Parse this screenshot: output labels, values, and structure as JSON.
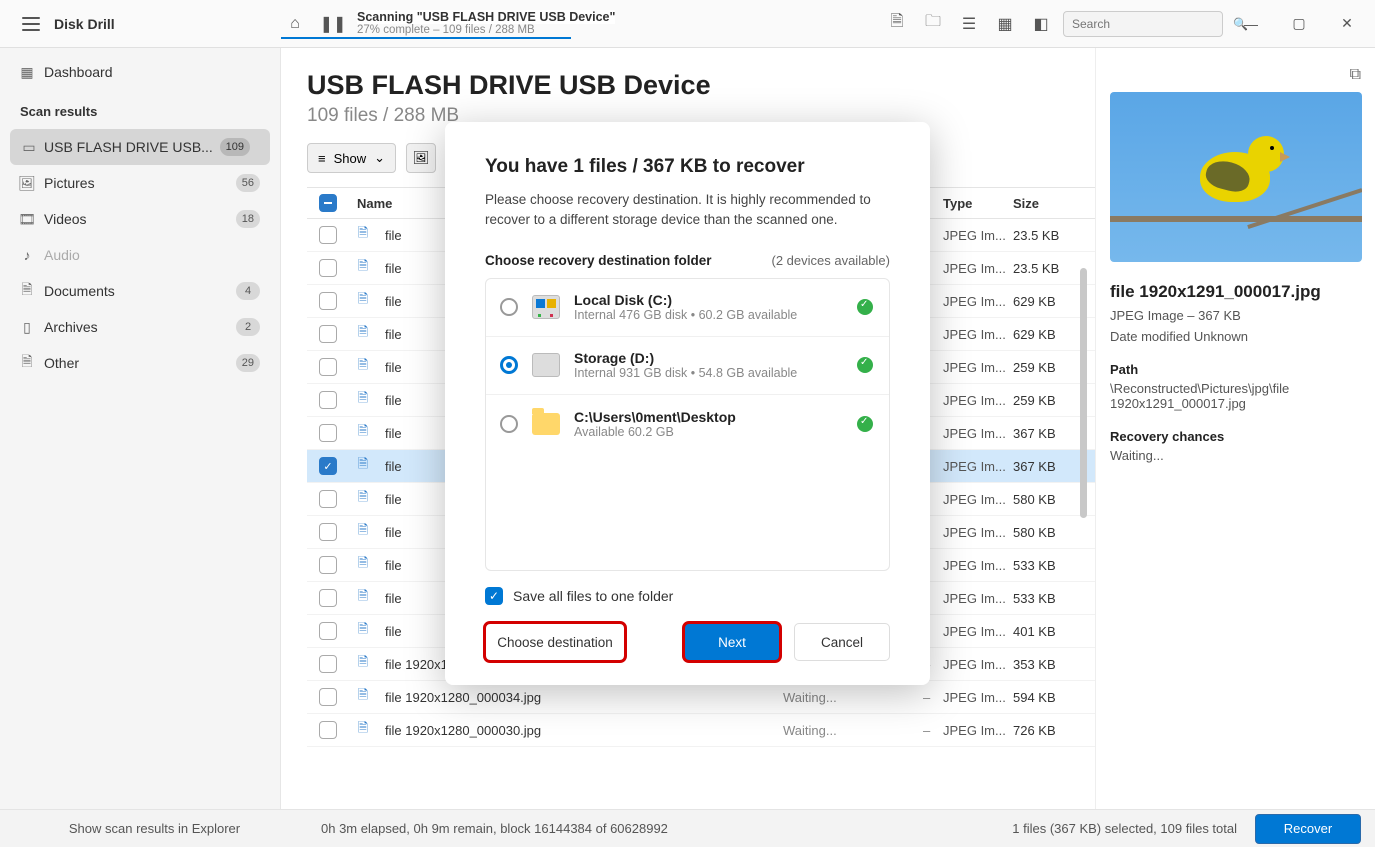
{
  "app": {
    "title": "Disk Drill"
  },
  "scan": {
    "title": "Scanning \"USB FLASH DRIVE USB Device\"",
    "subtitle": "27% complete – 109 files / 288 MB",
    "progress_pct": "27"
  },
  "search": {
    "placeholder": "Search"
  },
  "sidebar": {
    "dashboard": "Dashboard",
    "heading": "Scan results",
    "items": [
      {
        "label": "USB FLASH DRIVE USB...",
        "badge": "109"
      },
      {
        "label": "Pictures",
        "badge": "56"
      },
      {
        "label": "Videos",
        "badge": "18"
      },
      {
        "label": "Audio",
        "badge": ""
      },
      {
        "label": "Documents",
        "badge": "4"
      },
      {
        "label": "Archives",
        "badge": "2"
      },
      {
        "label": "Other",
        "badge": "29"
      }
    ]
  },
  "page": {
    "title": "USB FLASH DRIVE USB Device",
    "subtitle": "109 files / 288 MB"
  },
  "toolbar": {
    "show": "Show"
  },
  "columns": {
    "name": "Name",
    "status": "",
    "type": "Type",
    "size": "Size"
  },
  "rows": [
    {
      "name": "file",
      "status": "",
      "type": "JPEG Im...",
      "size": "23.5 KB"
    },
    {
      "name": "file",
      "status": "",
      "type": "JPEG Im...",
      "size": "23.5 KB"
    },
    {
      "name": "file",
      "status": "",
      "type": "JPEG Im...",
      "size": "629 KB"
    },
    {
      "name": "file",
      "status": "",
      "type": "JPEG Im...",
      "size": "629 KB"
    },
    {
      "name": "file",
      "status": "",
      "type": "JPEG Im...",
      "size": "259 KB"
    },
    {
      "name": "file",
      "status": "",
      "type": "JPEG Im...",
      "size": "259 KB"
    },
    {
      "name": "file",
      "status": "",
      "type": "JPEG Im...",
      "size": "367 KB"
    },
    {
      "name": "file",
      "status": "",
      "type": "JPEG Im...",
      "size": "367 KB",
      "selected": true
    },
    {
      "name": "file",
      "status": "",
      "type": "JPEG Im...",
      "size": "580 KB"
    },
    {
      "name": "file",
      "status": "",
      "type": "JPEG Im...",
      "size": "580 KB"
    },
    {
      "name": "file",
      "status": "",
      "type": "JPEG Im...",
      "size": "533 KB"
    },
    {
      "name": "file",
      "status": "",
      "type": "JPEG Im...",
      "size": "533 KB"
    },
    {
      "name": "file",
      "status": "",
      "type": "JPEG Im...",
      "size": "401 KB"
    },
    {
      "name": "file 1920x1280_000036.jpg",
      "status": "Waiting...",
      "dash": "–",
      "type": "JPEG Im...",
      "size": "353 KB"
    },
    {
      "name": "file 1920x1280_000034.jpg",
      "status": "Waiting...",
      "dash": "–",
      "type": "JPEG Im...",
      "size": "594 KB"
    },
    {
      "name": "file 1920x1280_000030.jpg",
      "status": "Waiting...",
      "dash": "–",
      "type": "JPEG Im...",
      "size": "726 KB"
    }
  ],
  "preview": {
    "filename": "file 1920x1291_000017.jpg",
    "typeinfo": "JPEG Image – 367 KB",
    "modified": "Date modified Unknown",
    "path_head": "Path",
    "path": "\\Reconstructed\\Pictures\\jpg\\file 1920x1291_000017.jpg",
    "rc_head": "Recovery chances",
    "rc_val": "Waiting..."
  },
  "status": {
    "explorer": "Show scan results in Explorer",
    "mid": "0h 3m elapsed, 0h 9m remain, block 16144384 of 60628992",
    "right": "1 files (367 KB) selected, 109 files total",
    "recover": "Recover"
  },
  "modal": {
    "title": "You have 1 files / 367 KB to recover",
    "desc": "Please choose recovery destination. It is highly recommended to recover to a different storage device than the scanned one.",
    "dest_head": "Choose recovery destination folder",
    "dest_count": "(2 devices available)",
    "destinations": [
      {
        "name": "Local Disk (C:)",
        "detail": "Internal 476 GB disk • 60.2 GB available"
      },
      {
        "name": "Storage (D:)",
        "detail": "Internal 931 GB disk • 54.8 GB available"
      },
      {
        "name": "C:\\Users\\0ment\\Desktop",
        "detail": "Available 60.2 GB"
      }
    ],
    "save_all": "Save all files to one folder",
    "choose": "Choose destination",
    "next": "Next",
    "cancel": "Cancel"
  }
}
